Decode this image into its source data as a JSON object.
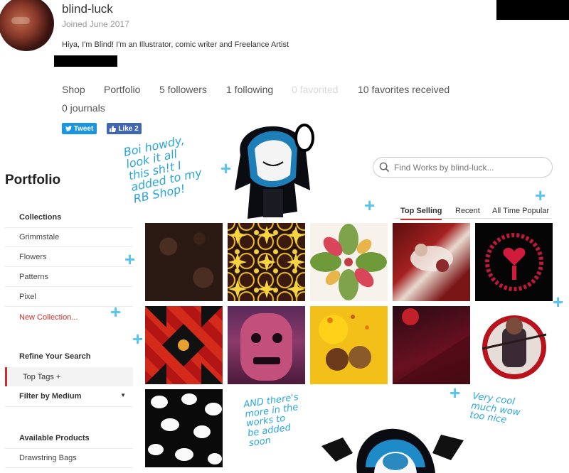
{
  "profile": {
    "username": "blind-luck",
    "joined": "Joined June 2017",
    "bio": "Hiya, I'm Blind! I'm an Illustrator, comic writer and Freelance Artist"
  },
  "nav": {
    "shop": "Shop",
    "portfolio": "Portfolio",
    "followers": "5 followers",
    "following": "1 following",
    "favorited": "0 favorited",
    "favorites_received": "10 favorites received",
    "journals": "0 journals"
  },
  "social": {
    "tweet": "Tweet",
    "like": "Like 2"
  },
  "sidebar": {
    "title": "Portfolio",
    "collections_heading": "Collections",
    "collections": [
      "Grimmstale",
      "Flowers",
      "Patterns",
      "Pixel"
    ],
    "new_collection": "New Collection...",
    "refine_heading": "Refine Your Search",
    "top_tags": "Top Tags +",
    "filter_medium": "Filter by Medium",
    "products_heading": "Available Products",
    "products": [
      "Drawstring Bags"
    ]
  },
  "search": {
    "placeholder": "Find Works by blind-luck..."
  },
  "sort_tabs": {
    "top_selling": "Top Selling",
    "recent": "Recent",
    "all_time": "All Time Popular"
  },
  "doodles": {
    "note1": "Boi howdy,\nlook it all\nthis sh!t I\nadded to my\nRB Shop!",
    "note2": "AND there's\nmore in the\nworks to\nbe added\nsoon",
    "note3": "Very cool\nmuch wow\ntoo nice"
  },
  "colors": {
    "accent_red": "#c3322e",
    "twitter_blue": "#1b95e0",
    "facebook_blue": "#4267b2",
    "doodle_blue": "#2aa6d8"
  }
}
